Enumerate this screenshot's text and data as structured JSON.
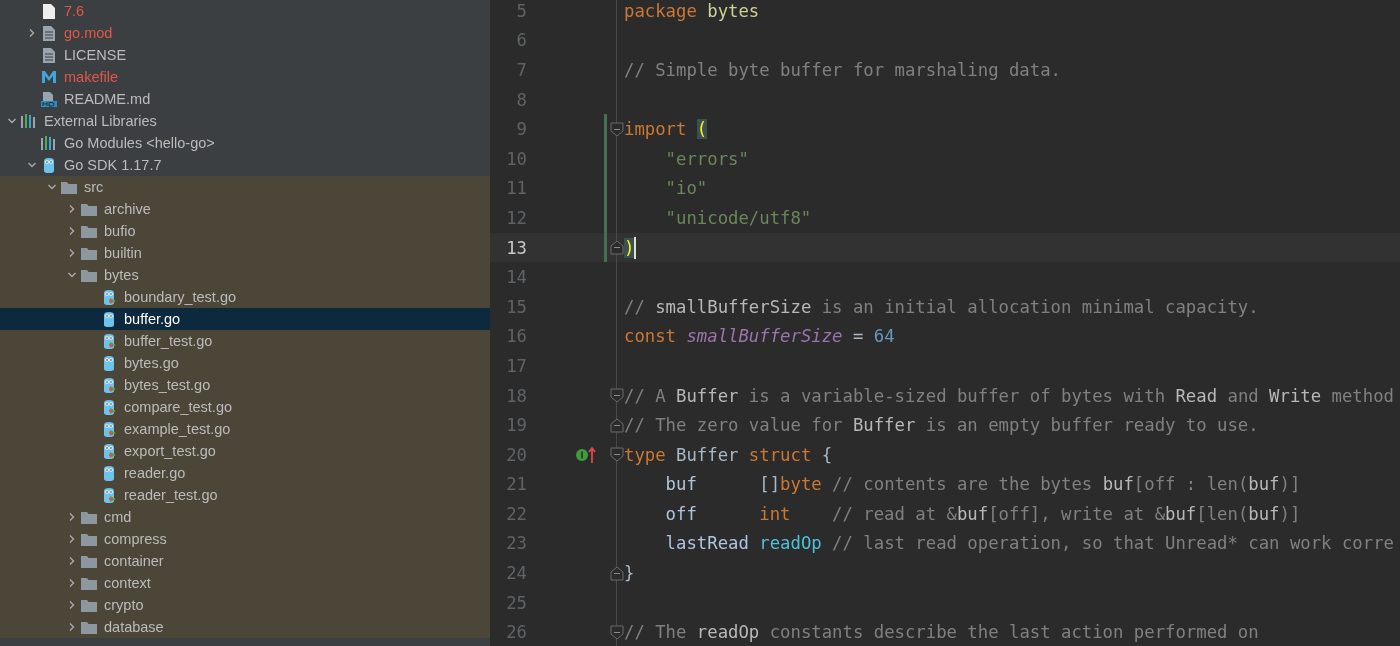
{
  "sidebar": {
    "project_files": [
      {
        "label": "7.6",
        "kind": "blank-file",
        "untracked": true,
        "selected": false
      },
      {
        "label": "go.mod",
        "kind": "text-file",
        "untracked": true,
        "expanded": false,
        "selected": false
      },
      {
        "label": "LICENSE",
        "kind": "text-file",
        "untracked": false,
        "selected": false
      },
      {
        "label": "makefile",
        "kind": "makefile",
        "untracked": true,
        "selected": false
      },
      {
        "label": "README.md",
        "kind": "markdown",
        "untracked": false,
        "selected": false
      }
    ],
    "tree": [
      {
        "label": "External Libraries",
        "kind": "library",
        "expanded": true,
        "selected": false,
        "children": [
          {
            "label": "Go Modules <hello-go>",
            "kind": "library",
            "selected": false
          },
          {
            "label": "Go SDK 1.17.7",
            "kind": "sdk",
            "expanded": true,
            "selected": false,
            "children": [
              {
                "label": "src",
                "kind": "folder",
                "expanded": true,
                "selected": false,
                "children": [
                  {
                    "label": "archive",
                    "kind": "folder",
                    "expanded": false,
                    "selected": false
                  },
                  {
                    "label": "bufio",
                    "kind": "folder",
                    "expanded": false,
                    "selected": false
                  },
                  {
                    "label": "builtin",
                    "kind": "folder",
                    "expanded": false,
                    "selected": false
                  },
                  {
                    "label": "bytes",
                    "kind": "folder",
                    "expanded": true,
                    "selected": false,
                    "children": [
                      {
                        "label": "boundary_test.go",
                        "kind": "go-test",
                        "selected": false
                      },
                      {
                        "label": "buffer.go",
                        "kind": "go-file",
                        "selected": true
                      },
                      {
                        "label": "buffer_test.go",
                        "kind": "go-test",
                        "selected": false
                      },
                      {
                        "label": "bytes.go",
                        "kind": "go-file",
                        "selected": false
                      },
                      {
                        "label": "bytes_test.go",
                        "kind": "go-test",
                        "selected": false
                      },
                      {
                        "label": "compare_test.go",
                        "kind": "go-test",
                        "selected": false
                      },
                      {
                        "label": "example_test.go",
                        "kind": "go-test",
                        "selected": false
                      },
                      {
                        "label": "export_test.go",
                        "kind": "go-test",
                        "selected": false
                      },
                      {
                        "label": "reader.go",
                        "kind": "go-file",
                        "selected": false
                      },
                      {
                        "label": "reader_test.go",
                        "kind": "go-test",
                        "selected": false
                      }
                    ]
                  },
                  {
                    "label": "cmd",
                    "kind": "folder",
                    "expanded": false,
                    "selected": false
                  },
                  {
                    "label": "compress",
                    "kind": "folder",
                    "expanded": false,
                    "selected": false
                  },
                  {
                    "label": "container",
                    "kind": "folder",
                    "expanded": false,
                    "selected": false
                  },
                  {
                    "label": "context",
                    "kind": "folder",
                    "expanded": false,
                    "selected": false
                  },
                  {
                    "label": "crypto",
                    "kind": "folder",
                    "expanded": false,
                    "selected": false
                  },
                  {
                    "label": "database",
                    "kind": "folder",
                    "expanded": false,
                    "selected": false
                  }
                ]
              }
            ]
          }
        ]
      }
    ]
  },
  "editor": {
    "lines": [
      {
        "number": "5",
        "current": false,
        "tokens": [
          {
            "kind": "keyword",
            "text": "package "
          },
          {
            "kind": "package",
            "text": "bytes"
          }
        ]
      },
      {
        "number": "6",
        "current": false
      },
      {
        "number": "7",
        "current": false,
        "tokens": [
          {
            "kind": "comment",
            "text": "// Simple byte buffer for marshaling data."
          }
        ]
      },
      {
        "number": "8",
        "current": false
      },
      {
        "number": "9",
        "current": false,
        "changed": true,
        "fold_start": true,
        "tokens": [
          {
            "kind": "keyword",
            "text": "import "
          },
          {
            "kind": "brace-match",
            "text": "("
          }
        ]
      },
      {
        "number": "10",
        "current": false,
        "changed": true,
        "tokens": [
          {
            "kind": "string",
            "text": "    \"errors\""
          }
        ]
      },
      {
        "number": "11",
        "current": false,
        "changed": true,
        "tokens": [
          {
            "kind": "string",
            "text": "    \"io\""
          }
        ]
      },
      {
        "number": "12",
        "current": false,
        "changed": true,
        "tokens": [
          {
            "kind": "string",
            "text": "    \"unicode/utf8\""
          }
        ]
      },
      {
        "number": "13",
        "current": true,
        "changed": true,
        "fold_end": true,
        "tokens": [
          {
            "kind": "brace-match",
            "text": ")"
          }
        ]
      },
      {
        "number": "14",
        "current": false
      },
      {
        "number": "15",
        "current": false,
        "tokens": [
          {
            "kind": "comment",
            "text": "// "
          },
          {
            "kind": "comment-ref",
            "text": "smallBufferSize"
          },
          {
            "kind": "comment",
            "text": " is an initial allocation minimal capacity."
          }
        ]
      },
      {
        "number": "16",
        "current": false,
        "tokens": [
          {
            "kind": "keyword",
            "text": "const "
          },
          {
            "kind": "constant",
            "text": "smallBufferSize"
          },
          {
            "kind": "plain",
            "text": " = "
          },
          {
            "kind": "number",
            "text": "64"
          }
        ]
      },
      {
        "number": "17",
        "current": false
      },
      {
        "number": "18",
        "current": false,
        "fold_start": true,
        "tokens": [
          {
            "kind": "comment",
            "text": "// A "
          },
          {
            "kind": "comment-ref",
            "text": "Buffer"
          },
          {
            "kind": "comment",
            "text": " is a variable-sized buffer of bytes with "
          },
          {
            "kind": "comment-ref",
            "text": "Read"
          },
          {
            "kind": "comment",
            "text": " and "
          },
          {
            "kind": "comment-ref",
            "text": "Write"
          },
          {
            "kind": "comment",
            "text": " method"
          }
        ]
      },
      {
        "number": "19",
        "current": false,
        "fold_end": true,
        "tokens": [
          {
            "kind": "comment",
            "text": "// The zero value for "
          },
          {
            "kind": "comment-ref",
            "text": "Buffer"
          },
          {
            "kind": "comment",
            "text": " is an empty buffer ready to use."
          }
        ]
      },
      {
        "number": "20",
        "current": false,
        "fold_start": true,
        "implemented_marker": true,
        "tokens": [
          {
            "kind": "keyword",
            "text": "type"
          },
          {
            "kind": "plain",
            "text": " Buffer "
          },
          {
            "kind": "keyword",
            "text": "struct"
          },
          {
            "kind": "plain",
            "text": " {"
          }
        ]
      },
      {
        "number": "21",
        "current": false,
        "tokens": [
          {
            "kind": "field",
            "text": "    buf      "
          },
          {
            "kind": "plain",
            "text": "[]"
          },
          {
            "kind": "keyword",
            "text": "byte"
          },
          {
            "kind": "comment",
            "text": " // contents are the bytes "
          },
          {
            "kind": "comment-ref",
            "text": "buf"
          },
          {
            "kind": "comment",
            "text": "[off : len("
          },
          {
            "kind": "comment-ref",
            "text": "buf"
          },
          {
            "kind": "comment",
            "text": ")]"
          }
        ]
      },
      {
        "number": "22",
        "current": false,
        "tokens": [
          {
            "kind": "field",
            "text": "    off      "
          },
          {
            "kind": "keyword",
            "text": "int"
          },
          {
            "kind": "comment",
            "text": "    // read at &"
          },
          {
            "kind": "comment-ref",
            "text": "buf"
          },
          {
            "kind": "comment",
            "text": "[off], write at &"
          },
          {
            "kind": "comment-ref",
            "text": "buf"
          },
          {
            "kind": "comment",
            "text": "[len("
          },
          {
            "kind": "comment-ref",
            "text": "buf"
          },
          {
            "kind": "comment",
            "text": ")]"
          }
        ]
      },
      {
        "number": "23",
        "current": false,
        "tokens": [
          {
            "kind": "field",
            "text": "    lastRead "
          },
          {
            "kind": "type-ref",
            "text": "readOp"
          },
          {
            "kind": "comment",
            "text": " // last read operation, so that Unread* can work corre"
          }
        ]
      },
      {
        "number": "24",
        "current": false,
        "fold_end": true,
        "tokens": [
          {
            "kind": "plain",
            "text": "}"
          }
        ]
      },
      {
        "number": "25",
        "current": false
      },
      {
        "number": "26",
        "current": false,
        "fold_start": true,
        "tokens": [
          {
            "kind": "comment",
            "text": "// The "
          },
          {
            "kind": "comment-ref",
            "text": "readOp"
          },
          {
            "kind": "comment",
            "text": " constants describe the last action performed on"
          }
        ]
      }
    ]
  }
}
